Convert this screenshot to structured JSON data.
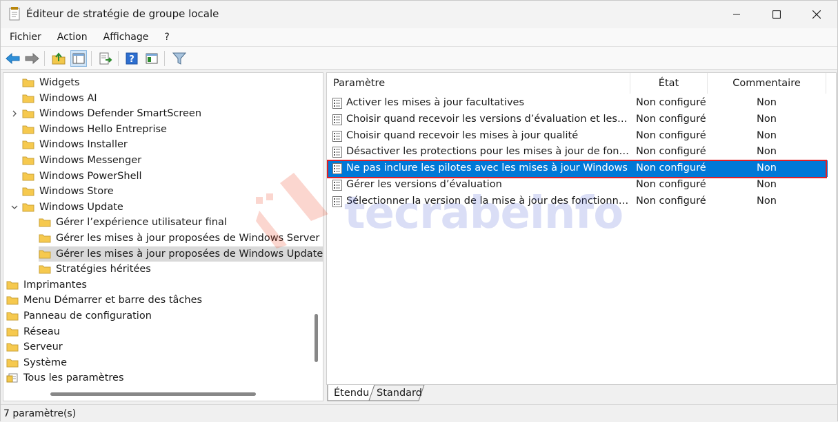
{
  "window": {
    "title": "Éditeur de stratégie de groupe locale",
    "controls": [
      "minimize",
      "maximize",
      "close"
    ]
  },
  "menubar": {
    "items": [
      "Fichier",
      "Action",
      "Affichage",
      "?"
    ]
  },
  "toolbar": {
    "buttons": [
      "back-icon",
      "forward-icon",
      "up-folder-icon",
      "show-hide-tree-icon",
      "export-list-icon",
      "help-icon",
      "extended-view-icon",
      "filter-icon"
    ]
  },
  "tree": {
    "items": [
      {
        "label": "Widgets",
        "level": 1,
        "expander": ""
      },
      {
        "label": "Windows AI",
        "level": 1,
        "expander": ""
      },
      {
        "label": "Windows Defender SmartScreen",
        "level": 1,
        "expander": "collapsed"
      },
      {
        "label": "Windows Hello Entreprise",
        "level": 1,
        "expander": ""
      },
      {
        "label": "Windows Installer",
        "level": 1,
        "expander": ""
      },
      {
        "label": "Windows Messenger",
        "level": 1,
        "expander": ""
      },
      {
        "label": "Windows PowerShell",
        "level": 1,
        "expander": ""
      },
      {
        "label": "Windows Store",
        "level": 1,
        "expander": ""
      },
      {
        "label": "Windows Update",
        "level": 1,
        "expander": "expanded"
      },
      {
        "label": "Gérer l’expérience utilisateur final",
        "level": 2,
        "expander": ""
      },
      {
        "label": "Gérer les mises à jour proposées de Windows Server Up",
        "level": 2,
        "expander": ""
      },
      {
        "label": "Gérer les mises à jour proposées de Windows Update",
        "level": 2,
        "expander": "",
        "selected": true
      },
      {
        "label": "Stratégies héritées",
        "level": 2,
        "expander": ""
      },
      {
        "label": "Imprimantes",
        "level": 0,
        "expander": ""
      },
      {
        "label": "Menu Démarrer et barre des tâches",
        "level": 0,
        "expander": ""
      },
      {
        "label": "Panneau de configuration",
        "level": 0,
        "expander": ""
      },
      {
        "label": "Réseau",
        "level": 0,
        "expander": ""
      },
      {
        "label": "Serveur",
        "level": 0,
        "expander": ""
      },
      {
        "label": "Système",
        "level": 0,
        "expander": ""
      },
      {
        "label": "Tous les paramètres",
        "level": 0,
        "expander": "",
        "icon": "settings-list-icon"
      }
    ]
  },
  "list": {
    "columns": [
      "Paramètre",
      "État",
      "Commentaire"
    ],
    "rows": [
      {
        "name": "Activer les mises à jour facultatives",
        "state": "Non configuré",
        "comment": "Non"
      },
      {
        "name": "Choisir quand recevoir les versions d’évaluation et les mises à jour de fonctionnalités",
        "state": "Non configuré",
        "comment": "Non"
      },
      {
        "name": "Choisir quand recevoir les mises à jour qualité",
        "state": "Non configuré",
        "comment": "Non"
      },
      {
        "name": "Désactiver les protections pour les mises à jour de fonctionnalités",
        "state": "Non configuré",
        "comment": "Non"
      },
      {
        "name": "Ne pas inclure les pilotes avec les mises à jour Windows",
        "state": "Non configuré",
        "comment": "Non",
        "selected": true
      },
      {
        "name": "Gérer les versions d’évaluation",
        "state": "Non configuré",
        "comment": "Non"
      },
      {
        "name": "Sélectionner la version de la mise à jour des fonctionnalités cible",
        "state": "Non configuré",
        "comment": "Non"
      }
    ]
  },
  "tabs": [
    "Étendu",
    "Standard"
  ],
  "status": {
    "text": "7 paramètre(s)"
  },
  "watermark": {
    "text": "tecrabeinfo"
  },
  "colors": {
    "selection": "#0078d7",
    "highlight_border": "#e01f26",
    "folder": "#f6c94e"
  }
}
